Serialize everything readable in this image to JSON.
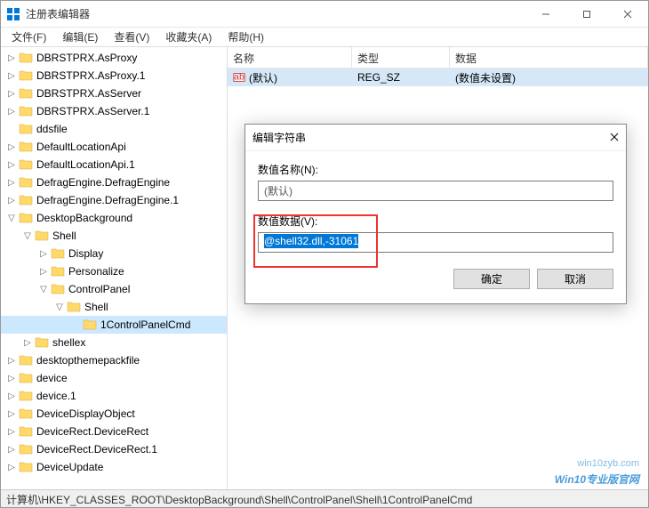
{
  "window": {
    "title": "注册表编辑器"
  },
  "menu": {
    "file": "文件(F)",
    "edit": "编辑(E)",
    "view": "查看(V)",
    "favorites": "收藏夹(A)",
    "help": "帮助(H)"
  },
  "tree": [
    {
      "indent": 0,
      "exp": "▷",
      "label": "DBRSTPRX.AsProxy"
    },
    {
      "indent": 0,
      "exp": "▷",
      "label": "DBRSTPRX.AsProxy.1"
    },
    {
      "indent": 0,
      "exp": "▷",
      "label": "DBRSTPRX.AsServer"
    },
    {
      "indent": 0,
      "exp": "▷",
      "label": "DBRSTPRX.AsServer.1"
    },
    {
      "indent": 0,
      "exp": "",
      "label": "ddsfile"
    },
    {
      "indent": 0,
      "exp": "▷",
      "label": "DefaultLocationApi"
    },
    {
      "indent": 0,
      "exp": "▷",
      "label": "DefaultLocationApi.1"
    },
    {
      "indent": 0,
      "exp": "▷",
      "label": "DefragEngine.DefragEngine"
    },
    {
      "indent": 0,
      "exp": "▷",
      "label": "DefragEngine.DefragEngine.1"
    },
    {
      "indent": 0,
      "exp": "▽",
      "label": "DesktopBackground"
    },
    {
      "indent": 1,
      "exp": "▽",
      "label": "Shell"
    },
    {
      "indent": 2,
      "exp": "▷",
      "label": "Display"
    },
    {
      "indent": 2,
      "exp": "▷",
      "label": "Personalize"
    },
    {
      "indent": 2,
      "exp": "▽",
      "label": "ControlPanel"
    },
    {
      "indent": 3,
      "exp": "▽",
      "label": "Shell"
    },
    {
      "indent": 4,
      "exp": "",
      "label": "1ControlPanelCmd",
      "selected": true
    },
    {
      "indent": 1,
      "exp": "▷",
      "label": "shellex"
    },
    {
      "indent": 0,
      "exp": "▷",
      "label": "desktopthemepackfile"
    },
    {
      "indent": 0,
      "exp": "▷",
      "label": "device"
    },
    {
      "indent": 0,
      "exp": "▷",
      "label": "device.1"
    },
    {
      "indent": 0,
      "exp": "▷",
      "label": "DeviceDisplayObject"
    },
    {
      "indent": 0,
      "exp": "▷",
      "label": "DeviceRect.DeviceRect"
    },
    {
      "indent": 0,
      "exp": "▷",
      "label": "DeviceRect.DeviceRect.1"
    },
    {
      "indent": 0,
      "exp": "▷",
      "label": "DeviceUpdate"
    }
  ],
  "list": {
    "headers": {
      "name": "名称",
      "type": "类型",
      "data": "数据"
    },
    "rows": [
      {
        "name": "(默认)",
        "type": "REG_SZ",
        "data": "(数值未设置)"
      }
    ]
  },
  "dialog": {
    "title": "编辑字符串",
    "name_label": "数值名称(N):",
    "name_value": "(默认)",
    "data_label": "数值数据(V):",
    "data_value": "@shell32.dll,-31061",
    "ok": "确定",
    "cancel": "取消"
  },
  "statusbar": "计算机\\HKEY_CLASSES_ROOT\\DesktopBackground\\Shell\\ControlPanel\\Shell\\1ControlPanelCmd",
  "watermark": {
    "url": "win10zyb.com",
    "text": "Win10专业版官网"
  }
}
